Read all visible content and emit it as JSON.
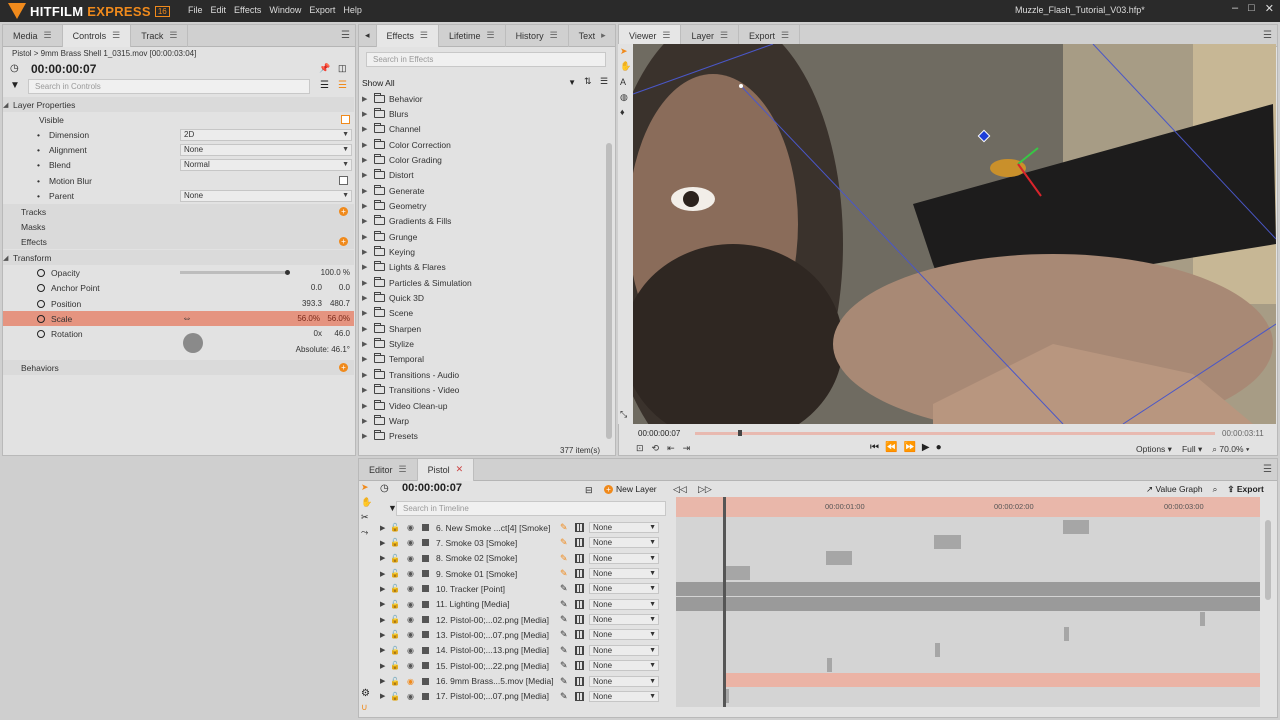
{
  "app": {
    "name_main": "HITFILM",
    "name_accent": " EXPRESS",
    "badge": "16",
    "document_title": "Muzzle_Flash_Tutorial_V03.hfp*",
    "menu": [
      "File",
      "Edit",
      "Effects",
      "Window",
      "Export",
      "Help"
    ],
    "window_controls": [
      "–",
      "□",
      "✕"
    ]
  },
  "left_panel": {
    "tabs": [
      "Media",
      "Controls",
      "Track"
    ],
    "path": "Pistol > 9mm Brass Shell 1_0315.mov [00:00:03:04]",
    "time": "00:00:00:07",
    "search_placeholder": "Search in Controls",
    "layer_properties_label": "Layer Properties",
    "visible_label": "Visible",
    "dimension_label": "Dimension",
    "dimension_value": "2D",
    "alignment_label": "Alignment",
    "alignment_value": "None",
    "blend_label": "Blend",
    "blend_value": "Normal",
    "motion_blur_label": "Motion Blur",
    "parent_label": "Parent",
    "parent_value": "None",
    "tracks_label": "Tracks",
    "masks_label": "Masks",
    "effects_label": "Effects",
    "transform_label": "Transform",
    "opacity_label": "Opacity",
    "opacity_value": "100.0 %",
    "opacity_level": 1.0,
    "anchor_label": "Anchor Point",
    "anchor_x": "0.0",
    "anchor_y": "0.0",
    "position_label": "Position",
    "position_x": "393.3",
    "position_y": "480.7",
    "scale_label": "Scale",
    "scale_x": "56.0%",
    "scale_y": "56.0%",
    "rotation_label": "Rotation",
    "rotation_turns": "0x",
    "rotation_deg": "46.0",
    "rotation_absolute": "Absolute: 46.1°",
    "behaviors_label": "Behaviors"
  },
  "effects_panel": {
    "tabs": [
      "Effects",
      "Lifetime",
      "History",
      "Text"
    ],
    "search_placeholder": "Search in Effects",
    "filter": "Show All",
    "folders": [
      "Behavior",
      "Blurs",
      "Channel",
      "Color Correction",
      "Color Grading",
      "Distort",
      "Generate",
      "Geometry",
      "Gradients & Fills",
      "Grunge",
      "Keying",
      "Lights & Flares",
      "Particles & Simulation",
      "Quick 3D",
      "Scene",
      "Sharpen",
      "Stylize",
      "Temporal",
      "Transitions - Audio",
      "Transitions - Video",
      "Video Clean-up",
      "Warp",
      "Presets"
    ],
    "count": "377 item(s)"
  },
  "viewer": {
    "tabs": [
      "Viewer",
      "Layer",
      "Export"
    ],
    "time": "00:00:00:07",
    "end_time": "00:00:03:11",
    "playhead_fraction": 0.083,
    "options_label": "Options",
    "quality_label": "Full",
    "zoom_label": "70.0%"
  },
  "editor": {
    "tabs": [
      "Editor",
      "Pistol"
    ],
    "time": "00:00:00:07",
    "new_layer_label": "New Layer",
    "search_placeholder": "Search in Timeline",
    "value_graph_label": "Value Graph",
    "export_label": "Export",
    "ticks": [
      "00:00:01:00",
      "00:00:02:00",
      "00:00:03:00"
    ],
    "layers": [
      {
        "name": "6. New Smoke ...ct[4] [Smoke]",
        "blend": "None"
      },
      {
        "name": "7. Smoke 03 [Smoke]",
        "blend": "None"
      },
      {
        "name": "8. Smoke 02 [Smoke]",
        "blend": "None"
      },
      {
        "name": "9. Smoke 01 [Smoke]",
        "blend": "None"
      },
      {
        "name": "10. Tracker [Point]",
        "blend": "None"
      },
      {
        "name": "11. Lighting [Media]",
        "blend": "None"
      },
      {
        "name": "12. Pistol-00;...02.png [Media]",
        "blend": "None"
      },
      {
        "name": "13. Pistol-00;...07.png [Media]",
        "blend": "None"
      },
      {
        "name": "14. Pistol-00;...13.png [Media]",
        "blend": "None"
      },
      {
        "name": "15. Pistol-00;...22.png [Media]",
        "blend": "None"
      },
      {
        "name": "16. 9mm Brass...5.mov [Media]",
        "blend": "None"
      },
      {
        "name": "17. Pistol-00;...07.png [Media]",
        "blend": "None"
      }
    ]
  },
  "colors": {
    "accent": "#f08a1c",
    "scale_highlight": "#e89a84",
    "ruler": "#e9b7aa"
  }
}
